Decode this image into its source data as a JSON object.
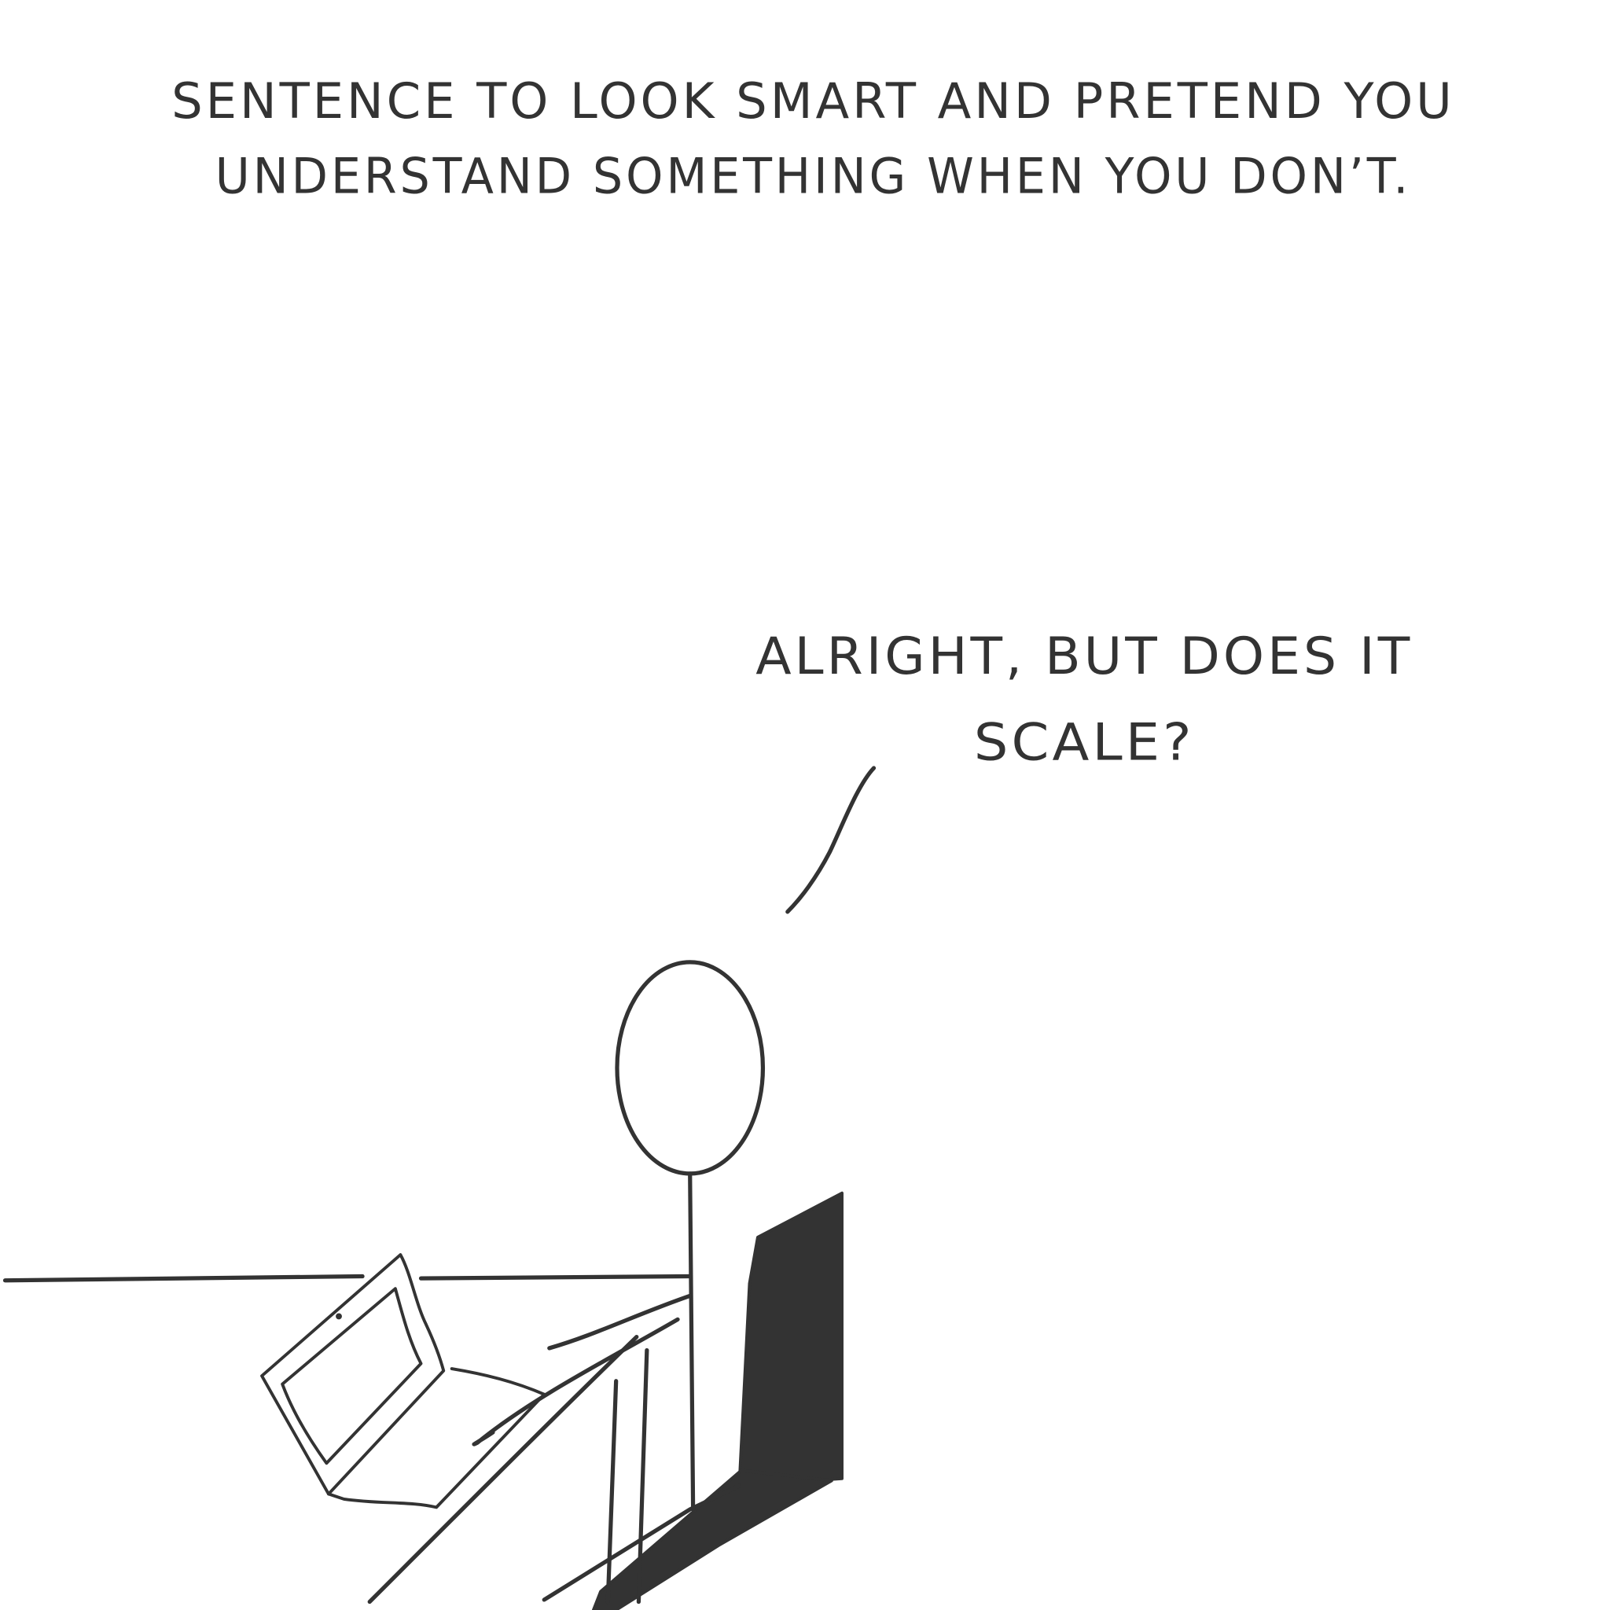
{
  "caption": {
    "line1": "SENTENCE TO LOOK SMART AND PRETEND YOU",
    "line2": "UNDERSTAND SOMETHING WHEN YOU DON’T."
  },
  "speech": {
    "line1": "ALRIGHT, BUT DOES IT",
    "line2": "SCALE?"
  },
  "colors": {
    "ink": "#333333",
    "background": "#ffffff"
  }
}
